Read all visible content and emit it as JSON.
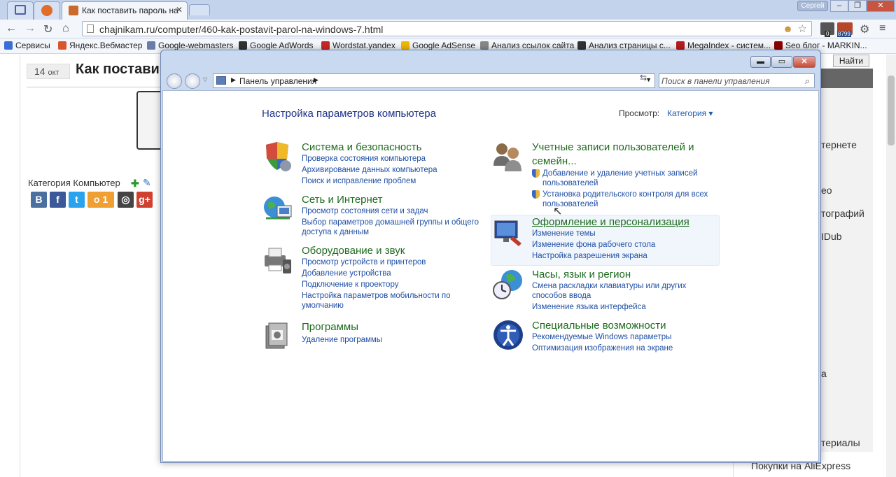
{
  "browser": {
    "tabs": [
      {
        "title": ""
      },
      {
        "title": ""
      },
      {
        "title": "Как поставить пароль на"
      }
    ],
    "user_badge": "Сергей",
    "window_buttons": [
      "–",
      "❐",
      "✕"
    ],
    "url": "chajnikam.ru/computer/460-kak-postavit-parol-na-windows-7.html",
    "badges": {
      "mail_count": "0",
      "counter": "8799"
    }
  },
  "bookmarks": [
    {
      "label": "Сервисы",
      "color": "#3b6fd4"
    },
    {
      "label": "Яндекс.Вебмастер",
      "color": "#d9552b"
    },
    {
      "label": "Google-webmasters",
      "color": "#6a7da8"
    },
    {
      "label": "Google AdWords",
      "color": "#333333"
    },
    {
      "label": "Wordstat.yandex",
      "color": "#c62828"
    },
    {
      "label": "Google AdSense",
      "color": "#f2b705"
    },
    {
      "label": "Анализ ссылок сайта",
      "color": "#888888"
    },
    {
      "label": "Анализ страницы с...",
      "color": "#333333"
    },
    {
      "label": "MegaIndex - систем...",
      "color": "#b71c1c"
    },
    {
      "label": "Seo блог - MARKIN...",
      "color": "#8b0000"
    }
  ],
  "website": {
    "date_day": "14",
    "date_month": "окт",
    "post_title": "Как постави",
    "category_label": "Категория Компьютер",
    "search_button": "Найти",
    "right_texts": [
      "тернете",
      "ео",
      "тографий",
      "IDub",
      "а",
      "териалы"
    ],
    "footer_link": "Покупки на AliExpress",
    "social": [
      {
        "label": "B",
        "color": "#4b6f9e"
      },
      {
        "label": "f",
        "color": "#3b5998"
      },
      {
        "label": "t",
        "color": "#2aa3ef"
      },
      {
        "label": "о 1",
        "color": "#f0a032"
      },
      {
        "label": "◎",
        "color": "#444444"
      },
      {
        "label": "g+",
        "color": "#d1402f"
      }
    ]
  },
  "control_panel": {
    "breadcrumb": "Панель управления",
    "search_placeholder": "Поиск в панели управления",
    "heading": "Настройка параметров компьютера",
    "view_label": "Просмотр:",
    "view_value": "Категория ▾",
    "categories": [
      {
        "title": "Система и безопасность",
        "icon": "shield-icon",
        "links": [
          "Проверка состояния компьютера",
          "Архивирование данных компьютера",
          "Поиск и исправление проблем"
        ]
      },
      {
        "title": "Сеть и Интернет",
        "icon": "network-globe-icon",
        "links": [
          "Просмотр состояния сети и задач",
          "Выбор параметров домашней группы и общего",
          "доступа к данным"
        ]
      },
      {
        "title": "Оборудование и звук",
        "icon": "printer-icon",
        "links": [
          "Просмотр устройств и принтеров",
          "Добавление устройства",
          "Подключение к проектору",
          "Настройка параметров мобильности по",
          "умолчанию"
        ]
      },
      {
        "title": "Программы",
        "icon": "programs-icon",
        "links": [
          "Удаление программы"
        ]
      },
      {
        "title_line1": "Учетные записи пользователей и",
        "title_line2": "семейн...",
        "icon": "users-icon",
        "links": [
          "Добавление и удаление учетных записей",
          "пользователей",
          "Установка родительского контроля для всех",
          "пользователей"
        ]
      },
      {
        "title": "Оформление и персонализация",
        "icon": "appearance-icon",
        "links": [
          "Изменение темы",
          "Изменение фона рабочего стола",
          "Настройка разрешения экрана"
        ]
      },
      {
        "title": "Часы, язык и регион",
        "icon": "clock-globe-icon",
        "links": [
          "Смена раскладки клавиатуры или других",
          "способов ввода",
          "Изменение языка интерфейса"
        ]
      },
      {
        "title": "Специальные возможности",
        "icon": "accessibility-icon",
        "links": [
          "Рекомендуемые Windows параметры",
          "Оптимизация изображения на экране"
        ]
      }
    ]
  },
  "colors": {
    "category_title": "#1e6b1e",
    "link": "#1f4fa5",
    "heading": "#1e3287"
  }
}
